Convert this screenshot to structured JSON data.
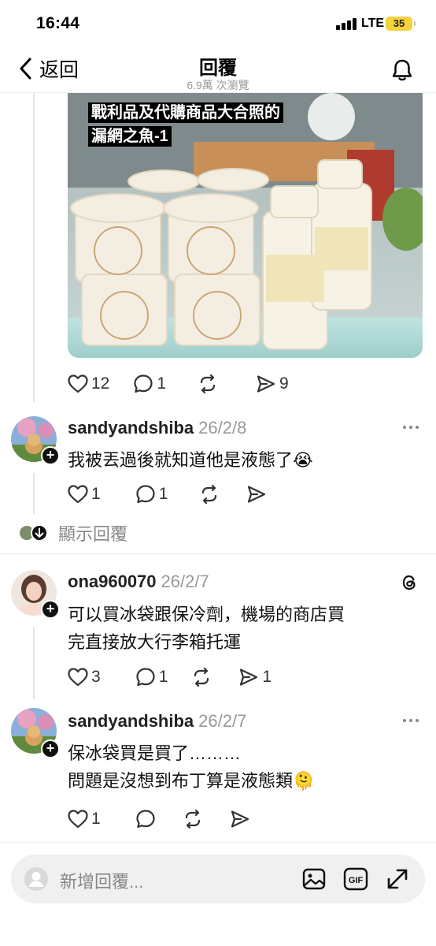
{
  "status_bar": {
    "time": "16:44",
    "network": "LTE",
    "battery": "35"
  },
  "nav": {
    "back_label": "返回",
    "title": "回覆",
    "subtitle": "6.9萬 次瀏覽"
  },
  "post": {
    "image_caption_line1": "戰利品及代購商品大合照的",
    "image_caption_line2": "漏網之魚-1",
    "likes": "12",
    "replies": "1",
    "reposts": "",
    "shares": "9"
  },
  "comments": [
    {
      "username": "sandyandshiba",
      "date": "26/2/8",
      "text_lines": [
        "我被丟過後就知道他是液態了😭"
      ],
      "likes": "1",
      "replies": "1",
      "reposts": "",
      "shares": ""
    },
    {
      "username": "ona960070",
      "date": "26/2/7",
      "text_lines": [
        "可以買冰袋跟保冷劑，機場的商店買",
        "完直接放大行李箱托運"
      ],
      "likes": "3",
      "replies": "1",
      "reposts": "",
      "shares": "1"
    },
    {
      "username": "sandyandshiba",
      "date": "26/2/7",
      "text_lines": [
        "保冰袋買是買了………",
        "問題是沒想到布丁算是液態類🫠"
      ],
      "likes": "1",
      "replies": "",
      "reposts": "",
      "shares": ""
    }
  ],
  "show_replies_label": "顯示回覆",
  "composer": {
    "placeholder": "新增回覆..."
  },
  "colors": {
    "text": "#000000",
    "muted": "#999999",
    "divider": "#e9e9e9",
    "battery": "#f3d23b"
  }
}
